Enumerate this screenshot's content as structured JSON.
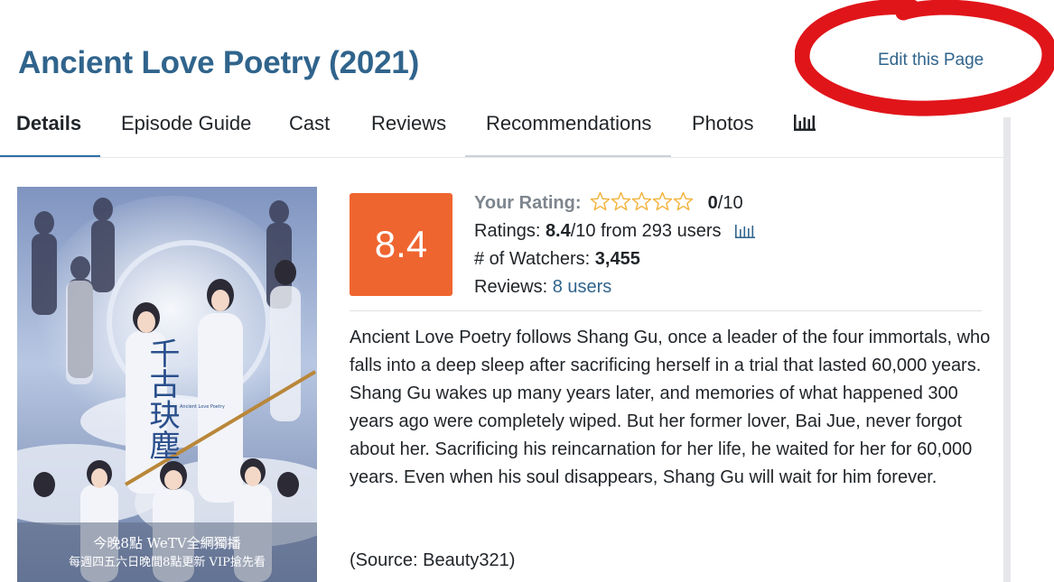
{
  "page": {
    "title": "Ancient Love Poetry (2021)",
    "edit_link": "Edit this Page"
  },
  "tabs": [
    {
      "label": "Details",
      "active": true
    },
    {
      "label": "Episode Guide"
    },
    {
      "label": "Cast"
    },
    {
      "label": "Reviews"
    },
    {
      "label": "Recommendations"
    },
    {
      "label": "Photos"
    },
    {
      "icon": "bar-chart-icon"
    }
  ],
  "poster": {
    "title_chars": "千古玦塵",
    "subtitle": "Ancient Love Poetry",
    "line1": "今晚8點 WeTV全網獨播",
    "line2": "每週四五六日晚間8點更新 VIP搶先看"
  },
  "rating": {
    "score": "8.4",
    "your_rating_label": "Your Rating:",
    "your_rating_value": "0",
    "your_rating_max": "/10",
    "ratings_label": "Ratings:",
    "ratings_value": "8.4",
    "ratings_rest": "/10 from 293 users",
    "watchers_label": "# of Watchers:",
    "watchers_value": "3,455",
    "reviews_label": "Reviews:",
    "reviews_link": "8 users",
    "stars_total": 5,
    "stars_filled": 0
  },
  "synopsis": "Ancient Love Poetry follows Shang Gu, once a leader of the four immortals, who falls into a deep sleep after sacrificing herself in a trial that lasted 60,000 years. Shang Gu wakes up many years later, and memories of what happened 300 years ago were completely wiped. But her former lover, Bai Jue, never forgot about her. Sacrificing his reincarnation for her life, he waited for her for 60,000 years. Even when his soul disappears, Shang Gu will wait for him forever.",
  "source": "(Source: Beauty321)",
  "colors": {
    "brand_blue": "#30648c",
    "score_orange": "#ef6530",
    "annotation_red": "#e0151a"
  }
}
